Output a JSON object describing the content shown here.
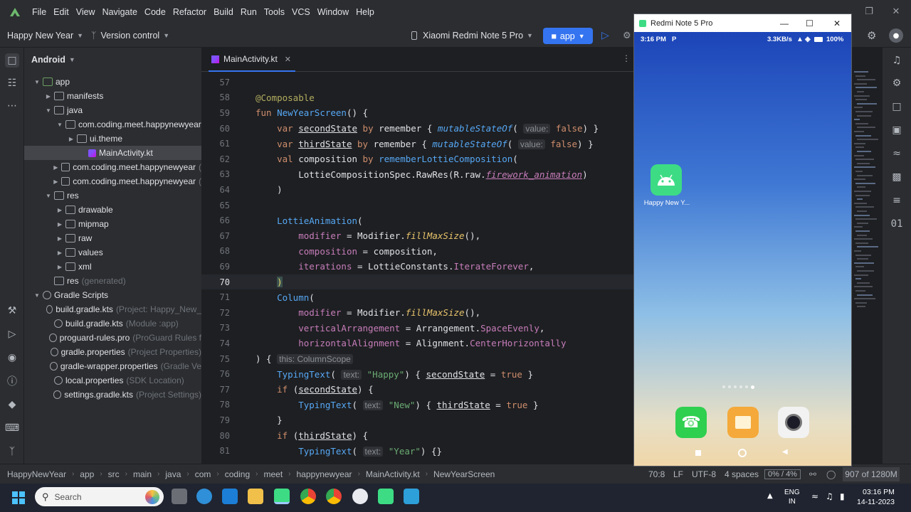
{
  "menu": [
    "File",
    "Edit",
    "View",
    "Navigate",
    "Code",
    "Refactor",
    "Build",
    "Run",
    "Tools",
    "VCS",
    "Window",
    "Help"
  ],
  "toolbar": {
    "project_name": "Happy New Year",
    "version_control": "Version control",
    "device": "Xiaomi Redmi Note 5 Pro",
    "run_config": "app"
  },
  "project_panel": {
    "title": "Android",
    "items": [
      {
        "label": "app",
        "extra": ""
      },
      {
        "label": "manifests",
        "extra": ""
      },
      {
        "label": "java",
        "extra": ""
      },
      {
        "label": "com.coding.meet.happynewyear",
        "extra": ""
      },
      {
        "label": "ui.theme",
        "extra": ""
      },
      {
        "label": "MainActivity.kt",
        "extra": ""
      },
      {
        "label": "com.coding.meet.happynewyear",
        "extra": "("
      },
      {
        "label": "com.coding.meet.happynewyear",
        "extra": "("
      },
      {
        "label": "res",
        "extra": ""
      },
      {
        "label": "drawable",
        "extra": ""
      },
      {
        "label": "mipmap",
        "extra": ""
      },
      {
        "label": "raw",
        "extra": ""
      },
      {
        "label": "values",
        "extra": ""
      },
      {
        "label": "xml",
        "extra": ""
      },
      {
        "label": "res",
        "extra": "(generated)"
      },
      {
        "label": "Gradle Scripts",
        "extra": ""
      },
      {
        "label": "build.gradle.kts",
        "extra": "(Project: Happy_New_"
      },
      {
        "label": "build.gradle.kts",
        "extra": "(Module :app)"
      },
      {
        "label": "proguard-rules.pro",
        "extra": "(ProGuard Rules f"
      },
      {
        "label": "gradle.properties",
        "extra": "(Project Properties)"
      },
      {
        "label": "gradle-wrapper.properties",
        "extra": "(Gradle Ve"
      },
      {
        "label": "local.properties",
        "extra": "(SDK Location)"
      },
      {
        "label": "settings.gradle.kts",
        "extra": "(Project Settings)"
      }
    ]
  },
  "editor": {
    "tab": "MainActivity.kt",
    "line_numbers": [
      "57",
      "58",
      "59",
      "60",
      "61",
      "62",
      "63",
      "64",
      "65",
      "66",
      "67",
      "68",
      "69",
      "70",
      "71",
      "72",
      "73",
      "74",
      "75",
      "76",
      "77",
      "78",
      "79",
      "80",
      "81"
    ],
    "hints": {
      "value": "value:",
      "this_scope": "this: ColumnScope",
      "text": "text:"
    }
  },
  "emulator": {
    "title": "Redmi Note 5 Pro",
    "time": "3:16 PM",
    "carrier_icon": "P",
    "speed": "3.3KB/s",
    "battery": "100%",
    "app_label": "Happy New Y..."
  },
  "statusbar": {
    "breadcrumbs": [
      "HappyNewYear",
      "app",
      "src",
      "main",
      "java",
      "com",
      "coding",
      "meet",
      "happynewyear",
      "MainActivity.kt",
      "NewYearScreen"
    ],
    "position": "70:8",
    "line_sep": "LF",
    "encoding": "UTF-8",
    "indent": "4 spaces",
    "progress": "0% / 4%",
    "memory": "907 of 1280M"
  },
  "taskbar": {
    "search": "Search",
    "lang": "ENG",
    "region": "IN",
    "time": "03:16 PM",
    "date": "14-11-2023"
  }
}
